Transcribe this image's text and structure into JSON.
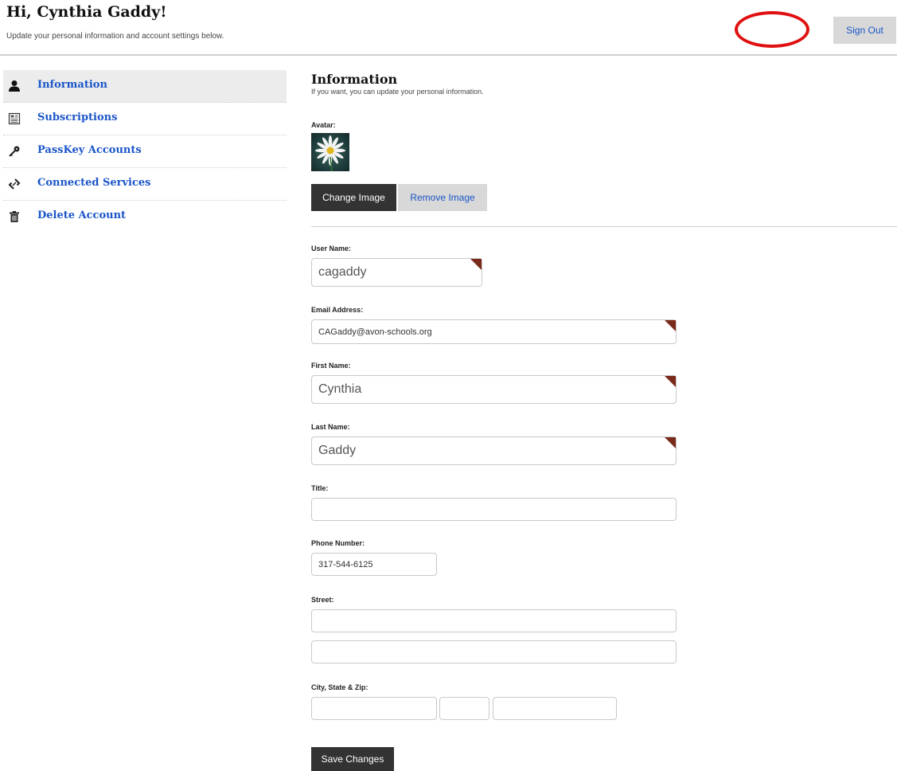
{
  "header": {
    "greeting": "Hi, Cynthia Gaddy!",
    "subtitle": "Update your personal information and account settings below.",
    "sign_out_label": "Sign Out"
  },
  "sidebar": {
    "items": [
      {
        "label": "Information",
        "icon": "user-icon",
        "active": true
      },
      {
        "label": "Subscriptions",
        "icon": "newspaper-icon",
        "active": false
      },
      {
        "label": "PassKey Accounts",
        "icon": "key-icon",
        "active": false
      },
      {
        "label": "Connected Services",
        "icon": "link-icon",
        "active": false
      },
      {
        "label": "Delete Account",
        "icon": "trash-icon",
        "active": false
      }
    ]
  },
  "main": {
    "title": "Information",
    "subtitle": "If you want, you can update your personal information.",
    "avatar_label": "Avatar:",
    "change_image_label": "Change Image",
    "remove_image_label": "Remove Image",
    "fields": {
      "username": {
        "label": "User Name:",
        "value": "cagaddy",
        "required": true
      },
      "email": {
        "label": "Email Address:",
        "value": "CAGaddy@avon-schools.org",
        "required": true
      },
      "first_name": {
        "label": "First Name:",
        "value": "Cynthia",
        "required": true
      },
      "last_name": {
        "label": "Last Name:",
        "value": "Gaddy",
        "required": true
      },
      "title": {
        "label": "Title:",
        "value": ""
      },
      "phone": {
        "label": "Phone Number:",
        "value": "317-544-6125"
      },
      "street": {
        "label": "Street:",
        "value_line1": "",
        "value_line2": ""
      },
      "city_state_zip": {
        "label": "City, State & Zip:",
        "city": "",
        "state": "",
        "zip": ""
      }
    },
    "save_label": "Save Changes"
  },
  "colors": {
    "link": "#1a55c8",
    "dark_button": "#333333",
    "light_button": "#d8d8d8",
    "required_marker": "#7a2a1a",
    "annotation": "#e01010"
  }
}
